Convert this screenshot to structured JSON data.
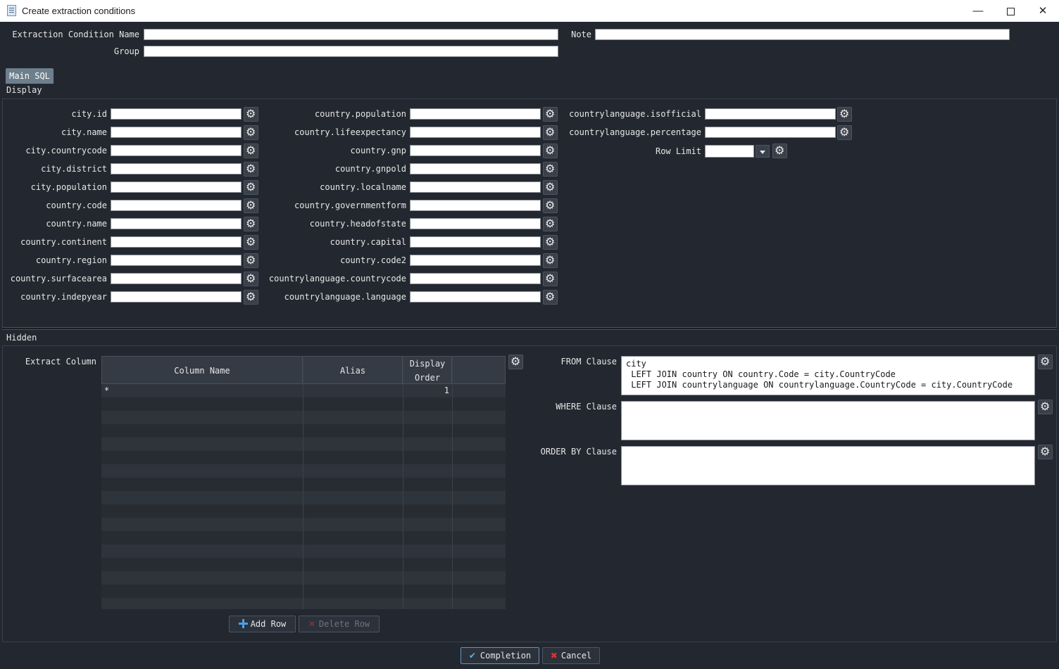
{
  "window": {
    "title": "Create extraction conditions",
    "minimize": "—",
    "close": "✕"
  },
  "header": {
    "name_label": "Extraction Condition Name",
    "name_value": "",
    "note_label": "Note",
    "note_value": "",
    "group_label": "Group",
    "group_value": ""
  },
  "tabs": [
    "Main SQL"
  ],
  "display": {
    "section_label": "Display",
    "col1": [
      "city.id",
      "city.name",
      "city.countrycode",
      "city.district",
      "city.population",
      "country.code",
      "country.name",
      "country.continent",
      "country.region",
      "country.surfacearea",
      "country.indepyear"
    ],
    "col2": [
      "country.population",
      "country.lifeexpectancy",
      "country.gnp",
      "country.gnpold",
      "country.localname",
      "country.governmentform",
      "country.headofstate",
      "country.capital",
      "country.code2",
      "countrylanguage.countrycode",
      "countrylanguage.language"
    ],
    "col3": [
      "countrylanguage.isofficial",
      "countrylanguage.percentage"
    ],
    "row_limit_label": "Row Limit",
    "row_limit_value": ""
  },
  "hidden": {
    "section_label": "Hidden",
    "extract_column_label": "Extract Column",
    "grid": {
      "headers": [
        "Column Name",
        "Alias",
        "Display Order",
        ""
      ],
      "rows": [
        {
          "column_name": "*",
          "alias": "",
          "display_order": "1"
        }
      ]
    },
    "add_row_label": "Add Row",
    "delete_row_label": "Delete Row",
    "from_label": "FROM Clause",
    "from_value": "city\n LEFT JOIN country ON country.Code = city.CountryCode\n LEFT JOIN countrylanguage ON countrylanguage.CountryCode = city.CountryCode",
    "where_label": "WHERE Clause",
    "where_value": "",
    "orderby_label": "ORDER BY Clause",
    "orderby_value": ""
  },
  "footer": {
    "completion_label": "Completion",
    "cancel_label": "Cancel"
  },
  "colors": {
    "background": "#232830",
    "tab_active": "#6d7f8d",
    "accent": "#4aa0e8",
    "cancel_icon": "#e03030"
  }
}
